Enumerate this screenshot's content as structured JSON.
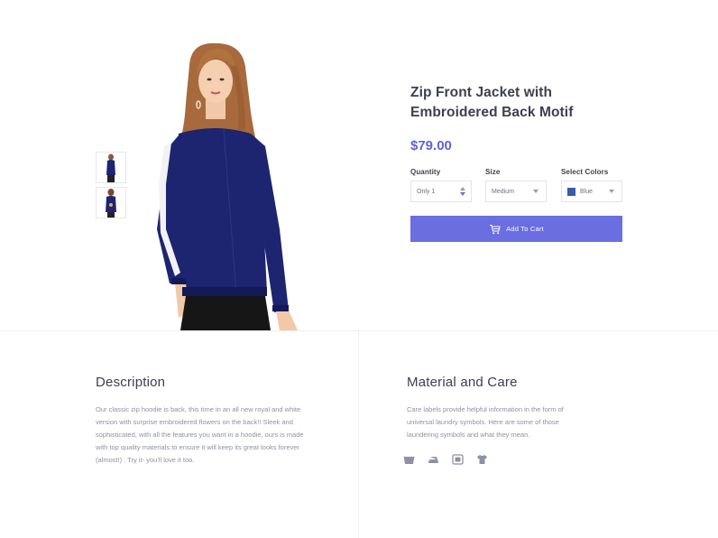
{
  "product": {
    "title_line1": "Zip Front Jacket with",
    "title_line2": "Embroidered Back Motif",
    "price": "$79.00",
    "image_alt": "model wearing navy zip front jacket"
  },
  "thumbnails": [
    {
      "name": "thumbnail-front"
    },
    {
      "name": "thumbnail-back"
    }
  ],
  "options": {
    "quantity": {
      "label": "Quantity",
      "value": "Only 1"
    },
    "size": {
      "label": "Size",
      "value": "Medium"
    },
    "color": {
      "label": "Select Colors",
      "value": "Blue",
      "swatch": "#3b5aa8"
    }
  },
  "cart": {
    "label": "Add To Cart",
    "icon": "cart-icon"
  },
  "description": {
    "title": "Description",
    "lines": [
      "Our classic zip hoodie is back, this time in an all new royal and white",
      "version with surprise embroidered flowers on the back!! Sleek and",
      "sophisticated, with all the features you want in a hoodie, ours is made",
      "with top quality materials to ensure it will keep its great looks forever",
      "(almost!) . Try it- you'll love it too."
    ]
  },
  "care": {
    "title": "Material and Care",
    "lines": [
      "Care labels provide helpful information in the form of",
      "universal laundry symbols. Here are some of those",
      "laundering symbols and what they mean."
    ],
    "icons": [
      "wash-icon",
      "iron-icon",
      "dry-clean-icon",
      "shirt-icon"
    ]
  },
  "colors": {
    "accent": "#6a6ee0",
    "price": "#5f63d5",
    "jacket": "#1d2470",
    "text": "#3d404f",
    "muted": "#8e91a3"
  }
}
